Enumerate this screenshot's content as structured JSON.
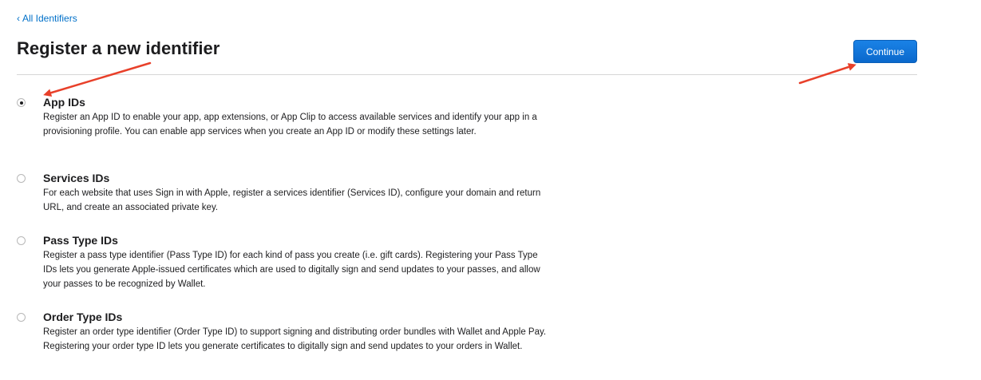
{
  "nav": {
    "back_chevron": "‹",
    "back_label": "All Identifiers"
  },
  "header": {
    "title": "Register a new identifier",
    "continue_label": "Continue"
  },
  "options": [
    {
      "title": "App IDs",
      "selected": true,
      "description": "Register an App ID to enable your app, app extensions, or App Clip to access available services and identify your app in a provisioning profile. You can enable app services when you create an App ID or modify these settings later."
    },
    {
      "title": "Services IDs",
      "selected": false,
      "description": "For each website that uses Sign in with Apple, register a services identifier (Services ID), configure your domain and return URL, and create an associated private key."
    },
    {
      "title": "Pass Type IDs",
      "selected": false,
      "description": "Register a pass type identifier (Pass Type ID) for each kind of pass you create (i.e. gift cards). Registering your Pass Type IDs lets you generate Apple-issued certificates which are used to digitally sign and send updates to your passes, and allow your passes to be recognized by Wallet."
    },
    {
      "title": "Order Type IDs",
      "selected": false,
      "description": "Register an order type identifier (Order Type ID) to support signing and distributing order bundles with Wallet and Apple Pay. Registering your order type ID lets you generate certificates to digitally sign and send updates to your orders in Wallet."
    }
  ],
  "colors": {
    "accent": "#0071e3",
    "link": "#0070c9",
    "annotation_arrow": "#e8402a"
  }
}
